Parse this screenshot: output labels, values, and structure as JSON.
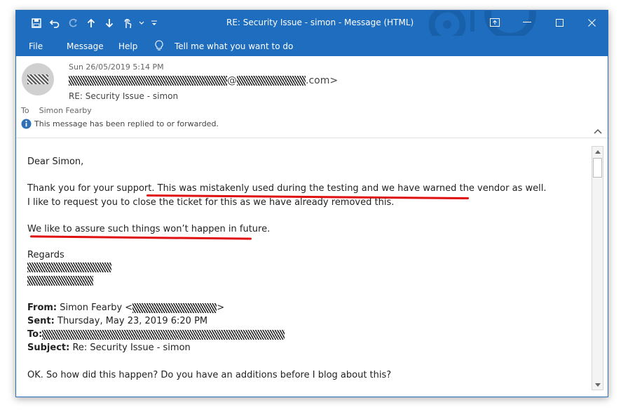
{
  "window": {
    "title": "RE: Security Issue - simon  -  Message (HTML)"
  },
  "menu": {
    "file": "File",
    "message": "Message",
    "help": "Help",
    "tell_me": "Tell me what you want to do"
  },
  "header": {
    "date": "Sun 26/05/2019 5:14 PM",
    "sender_suffix": ".com>",
    "sender_at": "@",
    "subject": "RE: Security Issue - simon",
    "to_label": "To",
    "to_name": "Simon Fearby",
    "info": "This message has been replied to or forwarded."
  },
  "body": {
    "greeting": "Dear Simon,",
    "p1_start": "Thank you for your support. ",
    "p1_highlight": "This was mistakenly used during the testing and we have warned the vendor",
    "p1_end": " as well.",
    "p2": "I like to request you to close the ticket for this as we have already removed this.",
    "p3": "We like to assure such things won’t happen in future.",
    "regards": "Regards",
    "from_label": "From:",
    "from_value": "Simon Fearby <",
    "from_close": ">",
    "sent_label": "Sent:",
    "sent_value": "Thursday, May 23, 2019 6:20 PM",
    "to_label": "To:",
    "subject_label": "Subject:",
    "subject_value": "Re: Security Issue - simon",
    "last": "OK. So how did this happen? Do you have an additions before I blog about this?"
  },
  "colors": {
    "accent": "#1f6dbf",
    "annotation": "#e01010"
  }
}
